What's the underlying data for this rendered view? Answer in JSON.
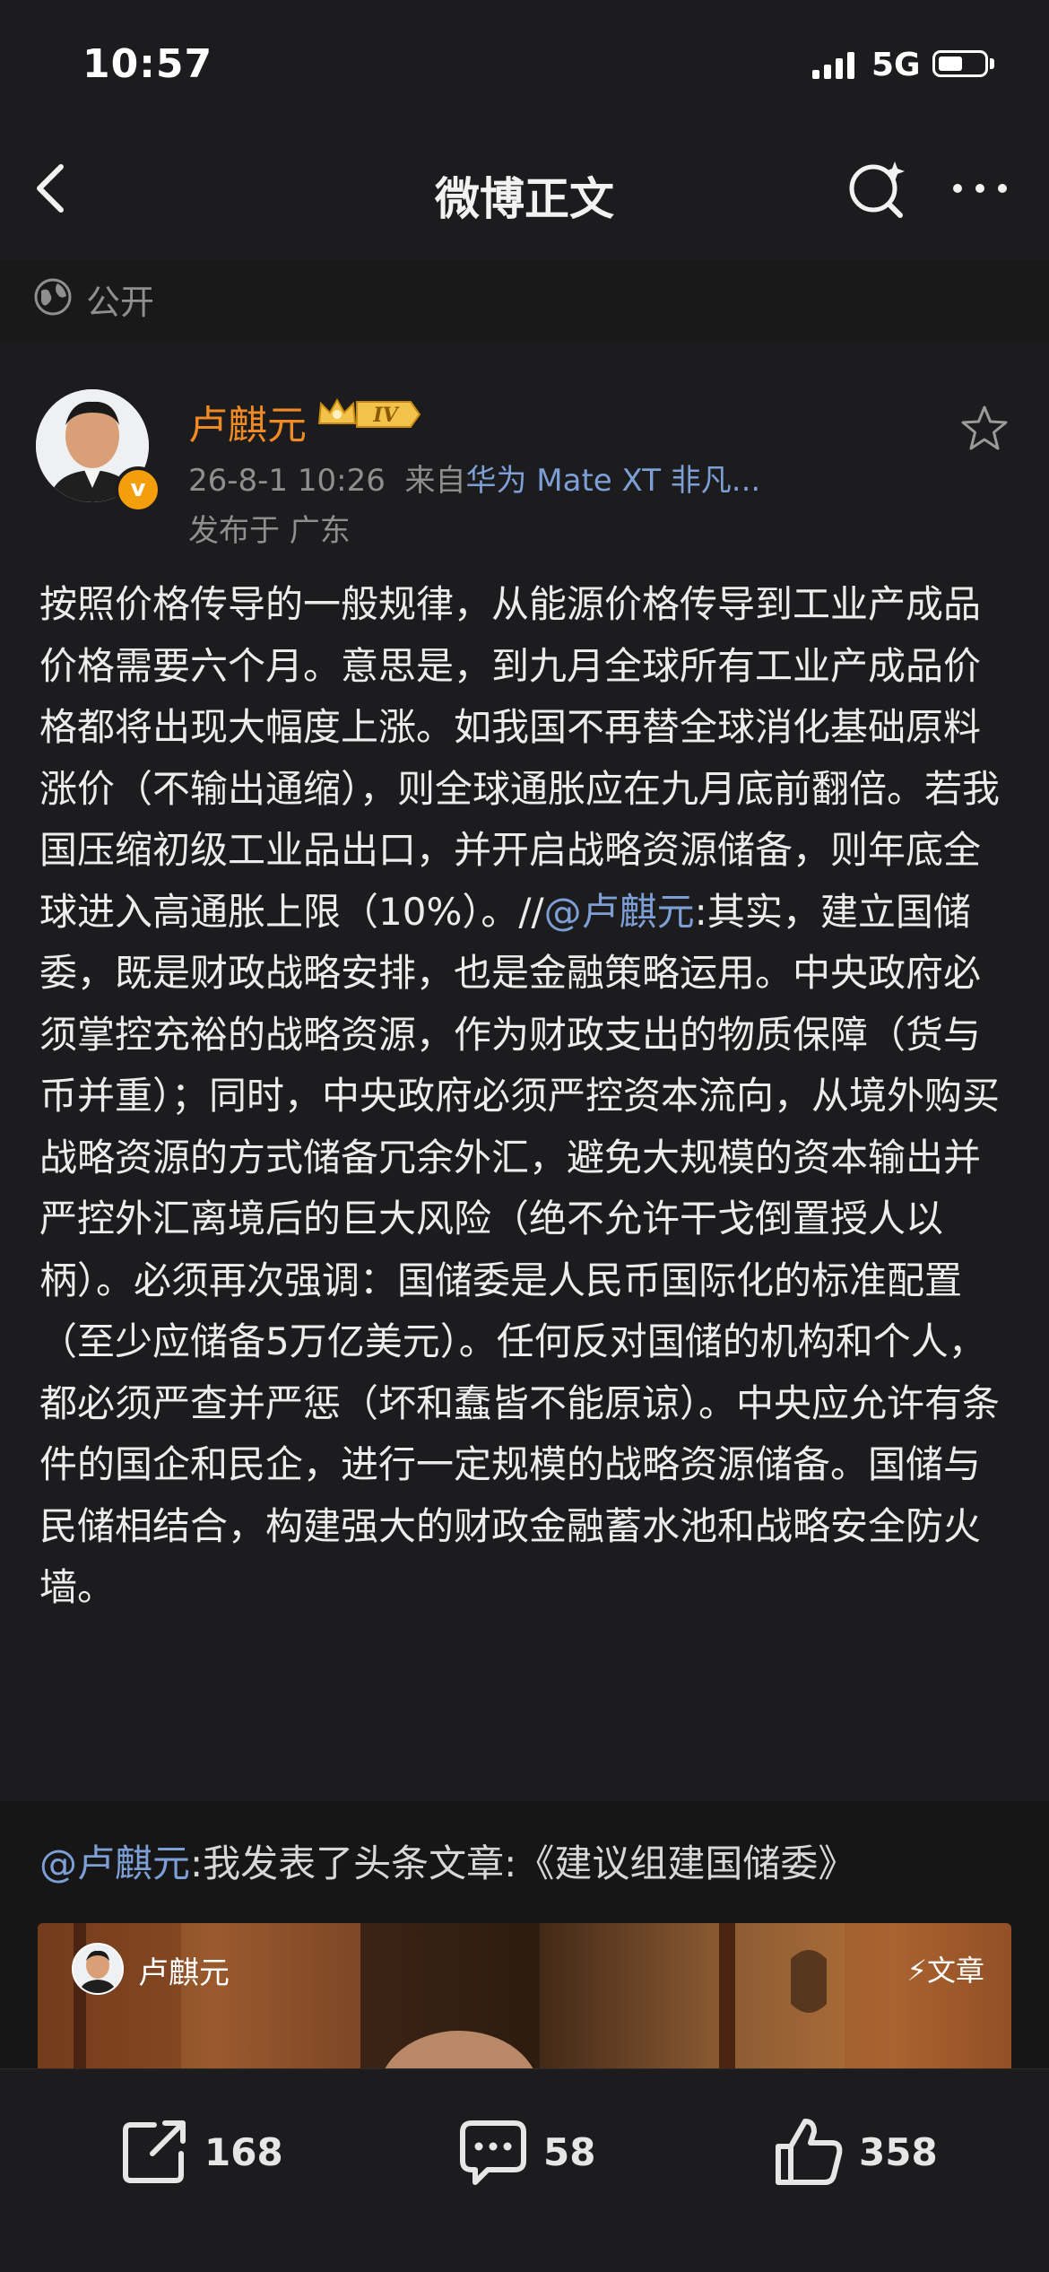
{
  "status_bar": {
    "time": "10:57",
    "network": "5G"
  },
  "nav": {
    "title": "微博正文"
  },
  "visibility": {
    "label": "公开"
  },
  "post": {
    "author": "卢麒元",
    "level_badge": "IV",
    "timestamp": "26-8-1 10:26",
    "source_prefix": "来自",
    "source": "华为 Mate XT 非凡...",
    "location": "发布于 广东",
    "text_part1": "按照价格传导的一般规律，从能源价格传导到工业产成品价格需要六个月。意思是，到九月全球所有工业产成品价格都将出现大幅度上涨。如我国不再替全球消化基础原料涨价（不输出通缩），则全球通胀应在九月底前翻倍。若我国压缩初级工业品出口，并开启战略资源储备，则年底全球进入高通胀上限（10%）。//",
    "mention": "@卢麒元",
    "text_part2": ":其实，建立国储委，既是财政战略安排，也是金融策略运用。中央政府必须掌控充裕的战略资源，作为财政支出的物质保障（货与币并重）；同时，中央政府必须严控资本流向，从境外购买战略资源的方式储备冗余外汇，避免大规模的资本输出并严控外汇离境后的巨大风险（绝不允许干戈倒置授人以柄）。必须再次强调：国储委是人民币国际化的标准配置（至少应储备5万亿美元）。任何反对国储的机构和个人，都必须严查并严惩（坏和蠢皆不能原谅）。中央应允许有条件的国企和民企，进行一定规模的战略资源储备。国储与民储相结合，构建强大的财政金融蓄水池和战略安全防火墙。"
  },
  "retweet": {
    "mention": "@卢麒元",
    "text": ":我发表了头条文章:《建议组建国储委》",
    "card_author": "卢麒元",
    "card_tag": "文章"
  },
  "actions": {
    "repost_count": "168",
    "comment_count": "58",
    "like_count": "358"
  },
  "colors": {
    "background": "#1c1c1e",
    "username": "#f08a24",
    "link": "#7d9fd6"
  },
  "icons": [
    "back-icon",
    "search-icon",
    "more-icon",
    "globe-icon",
    "star-icon",
    "repost-icon",
    "comment-icon",
    "like-icon"
  ]
}
